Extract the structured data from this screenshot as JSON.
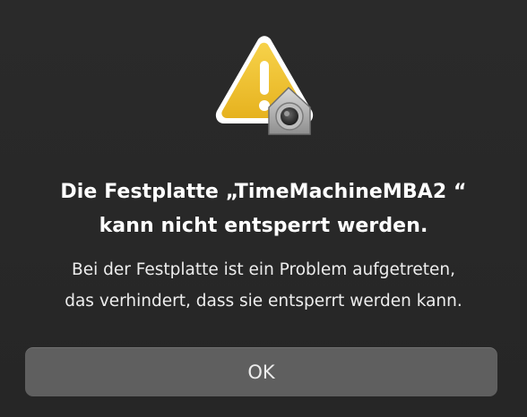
{
  "dialog": {
    "icon": "warning-triangle-with-lock-icon",
    "title_line1": "Die Festplatte „TimeMachineMBA2 “",
    "title_line2": "kann nicht entsperrt werden.",
    "message_line1": "Bei der Festplatte ist ein Problem aufgetreten,",
    "message_line2": "das verhindert, dass sie entsperrt werden kann.",
    "ok_label": "OK"
  },
  "colors": {
    "background": "#282828",
    "warning_yellow": "#f2c230",
    "button_fill": "#5f5f5f",
    "text": "#ffffff"
  }
}
